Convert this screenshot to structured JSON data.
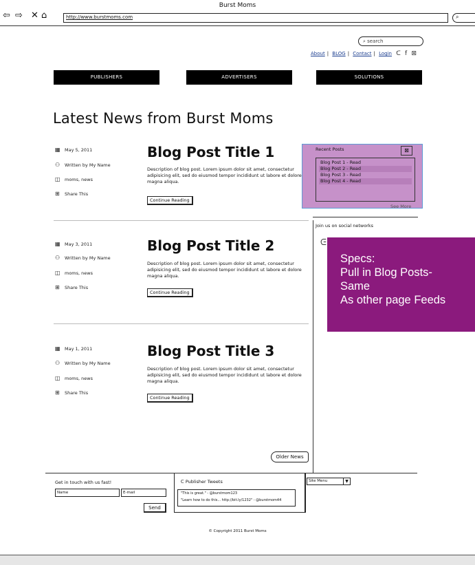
{
  "browser": {
    "window_title": "Burst Moms",
    "url": "http://www.burstmoms.com",
    "nav_icons": [
      "back-icon",
      "forward-icon",
      "close-icon",
      "home-icon"
    ]
  },
  "header": {
    "search_placeholder": "search",
    "links": [
      "About",
      "BLOG",
      "Contact",
      "Login"
    ],
    "social_icons": [
      "twitter-icon",
      "facebook-icon",
      "rss-icon"
    ]
  },
  "nav": [
    "PUBLISHERS",
    "ADVERTISERS",
    "SOLUTIONS"
  ],
  "page_title": "Latest News from Burst Moms",
  "posts": [
    {
      "date": "May 5, 2011",
      "author": "Written by My Name",
      "tags": "moms, news",
      "share": "Share This",
      "title": "Blog Post Title 1",
      "description": "Description of blog post. Lorem ipsum dolor sit amet, consectetur adipisicing elit, sed do eiusmod tempor incididunt ut labore et dolore magna aliqua.",
      "button": "Continue Reading"
    },
    {
      "date": "May 3, 2011",
      "author": "Written by My Name",
      "tags": "moms, news",
      "share": "Share This",
      "title": "Blog Post Title 2",
      "description": "Description of blog post. Lorem ipsum dolor sit amet, consectetur adipisicing elit, sed do eiusmod tempor incididunt ut labore et dolore magna aliqua.",
      "button": "Continue Reading"
    },
    {
      "date": "May 1, 2011",
      "author": "Written by My Name",
      "tags": "moms, news",
      "share": "Share This",
      "title": "Blog Post Title 3",
      "description": "Description of blog post. Lorem ipsum dolor sit amet, consectetur adipisicing elit, sed do eiusmod tempor incididunt ut labore et dolore magna aliqua.",
      "button": "Continue Reading"
    }
  ],
  "recent_posts": {
    "title": "Recent Posts",
    "items": [
      "Blog Post 1 - Read",
      "Blog Post 2 - Read",
      "Blog Post 3 - Read",
      "Blog Post 4 - Read"
    ],
    "see_more": "See More"
  },
  "social": {
    "label": "Join us on social networks"
  },
  "spec_note": {
    "lines": [
      "Specs:",
      "Pull in Blog Posts-",
      "Same",
      "As other page Feeds"
    ],
    "color": "#8b1a7d"
  },
  "older_news": "Older News",
  "footer": {
    "contact_title": "Get in touch with us fast!",
    "name_placeholder": "Name",
    "email_placeholder": "E-mail",
    "send": "Send",
    "tweets_title": "Publisher Tweets",
    "tweets": [
      "\"This is great.\" - @burstmom123",
      "\"Learn how to do this... http://bit.ly/1232\" - @burstmom44"
    ],
    "site_menu": "Site Menu",
    "copyright": "© Copyright 2011 Burst Moms"
  },
  "colors": {
    "recent_box": "#c691c9",
    "recent_box_border": "#5b9bd5",
    "link": "#1a3d8f"
  }
}
